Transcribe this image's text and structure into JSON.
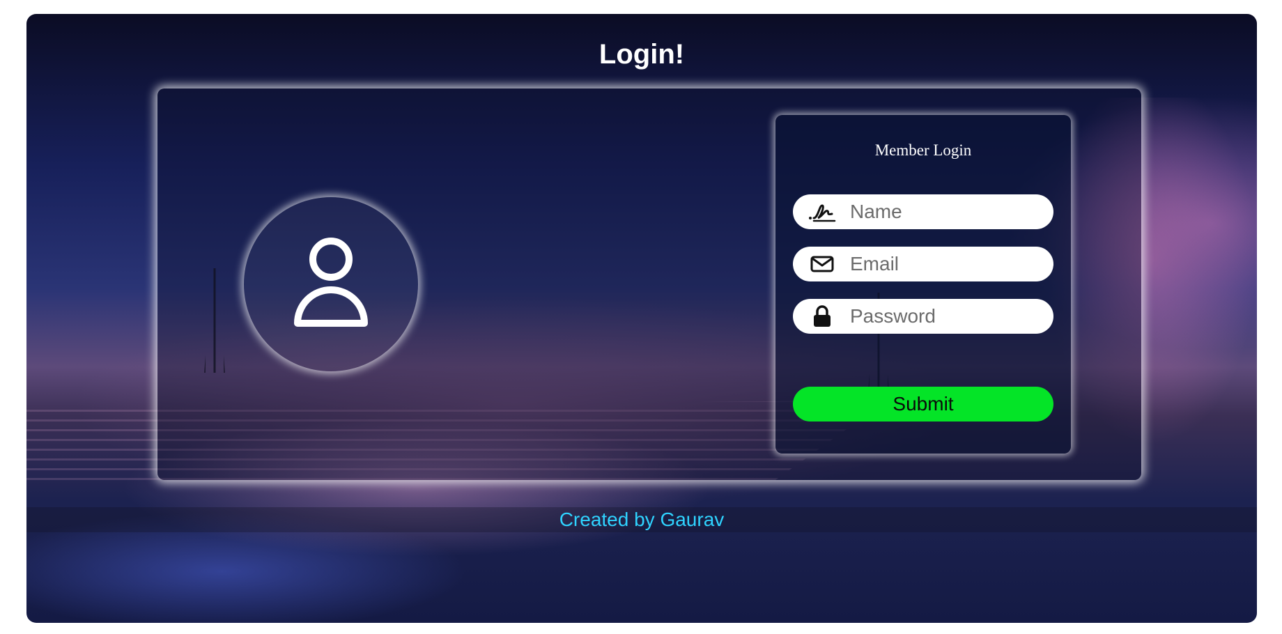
{
  "page": {
    "title": "Login!",
    "footer_text": "Created by Gaurav"
  },
  "login_panel": {
    "title": "Member Login",
    "fields": {
      "name": {
        "placeholder": "Name",
        "icon": "signature-icon"
      },
      "email": {
        "placeholder": "Email",
        "icon": "envelope-icon"
      },
      "password": {
        "placeholder": "Password",
        "icon": "lock-icon"
      }
    },
    "submit_label": "Submit"
  },
  "avatar": {
    "icon": "user-icon"
  },
  "colors": {
    "submit": "#04e427",
    "footer_text": "#2fd3ff",
    "heading": "#ffffff"
  }
}
